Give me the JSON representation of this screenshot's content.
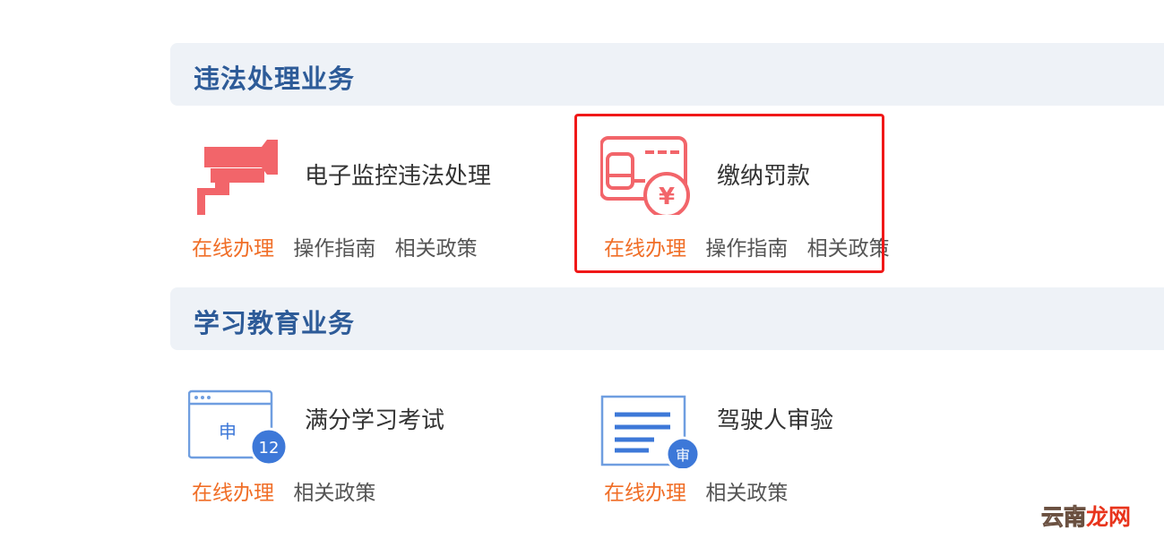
{
  "sections": [
    {
      "title": "违法处理业务",
      "cards": [
        {
          "title": "电子监控违法处理",
          "icon": "surveillance-camera-icon",
          "links": [
            "在线办理",
            "操作指南",
            "相关政策"
          ]
        },
        {
          "title": "缴纳罚款",
          "icon": "fine-payment-icon",
          "links": [
            "在线办理",
            "操作指南",
            "相关政策"
          ]
        }
      ]
    },
    {
      "title": "学习教育业务",
      "cards": [
        {
          "title": "满分学习考试",
          "icon": "application-window-icon",
          "badge": "12",
          "badge_label": "申",
          "links": [
            "在线办理",
            "相关政策"
          ]
        },
        {
          "title": "驾驶人审验",
          "icon": "document-review-icon",
          "badge": "审",
          "links": [
            "在线办理",
            "相关政策"
          ]
        }
      ]
    }
  ],
  "watermark": {
    "part1": "云南",
    "part2": "龙网"
  },
  "colors": {
    "section_title": "#2d5b98",
    "primary_link": "#f06e27",
    "icon_red": "#f2656a",
    "icon_blue": "#3d78d8",
    "highlight": "#f01818"
  }
}
